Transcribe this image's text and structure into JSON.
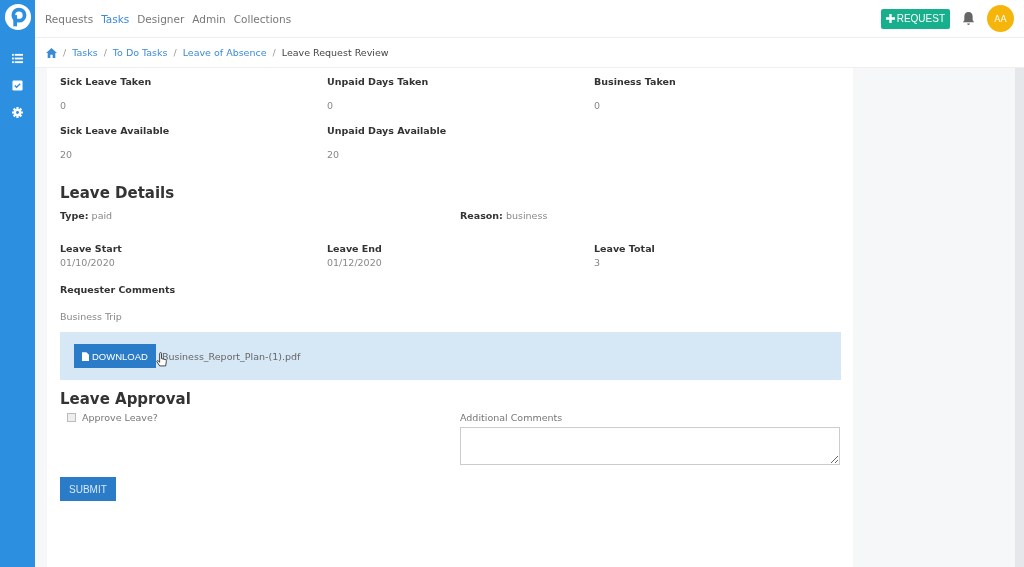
{
  "nav": {
    "items": [
      {
        "label": "Requests",
        "selected": false
      },
      {
        "label": "Tasks",
        "selected": true
      },
      {
        "label": "Designer",
        "selected": false
      },
      {
        "label": "Admin",
        "selected": false
      },
      {
        "label": "Collections",
        "selected": false
      }
    ],
    "request_button": "REQUEST",
    "avatar": "AA"
  },
  "breadcrumb": [
    {
      "separator": "/",
      "label": "Tasks",
      "kind": "link"
    },
    {
      "separator": "/",
      "label": "To Do Tasks",
      "kind": "link"
    },
    {
      "separator": "/",
      "label": "Leave of Absence",
      "kind": "link"
    },
    {
      "separator": "/",
      "label": "Leave Request Review",
      "kind": "current"
    }
  ],
  "additional_details": [
    {
      "label": "Sick Leave Taken",
      "value": "0"
    },
    {
      "label": "Unpaid Days Taken",
      "value": "0"
    },
    {
      "label": "Business Taken",
      "value": "0"
    },
    {
      "label": "Sick Leave Available",
      "value": "20"
    },
    {
      "label": "Unpaid Days Available",
      "value": "20"
    }
  ],
  "leave_details": {
    "title": "Leave Details",
    "type": {
      "label": "Type:",
      "value": "paid"
    },
    "reason": {
      "label": "Reason:",
      "value": "business"
    },
    "fields": [
      {
        "label": "Leave Start",
        "value": "01/10/2020"
      },
      {
        "label": "Leave End",
        "value": "01/12/2020"
      },
      {
        "label": "Leave Total",
        "value": "3"
      }
    ],
    "comments_label": "Requester Comments",
    "comments": "Business Trip",
    "download_button": "DOWNLOAD",
    "file_name": "Business_Report_Plan-(1).pdf"
  },
  "leave_approval": {
    "title": "Leave Approval",
    "approve_label": "Approve Leave?",
    "approve_checked": false,
    "comments_label": "Additional Comments",
    "submit": "SUBMIT"
  }
}
